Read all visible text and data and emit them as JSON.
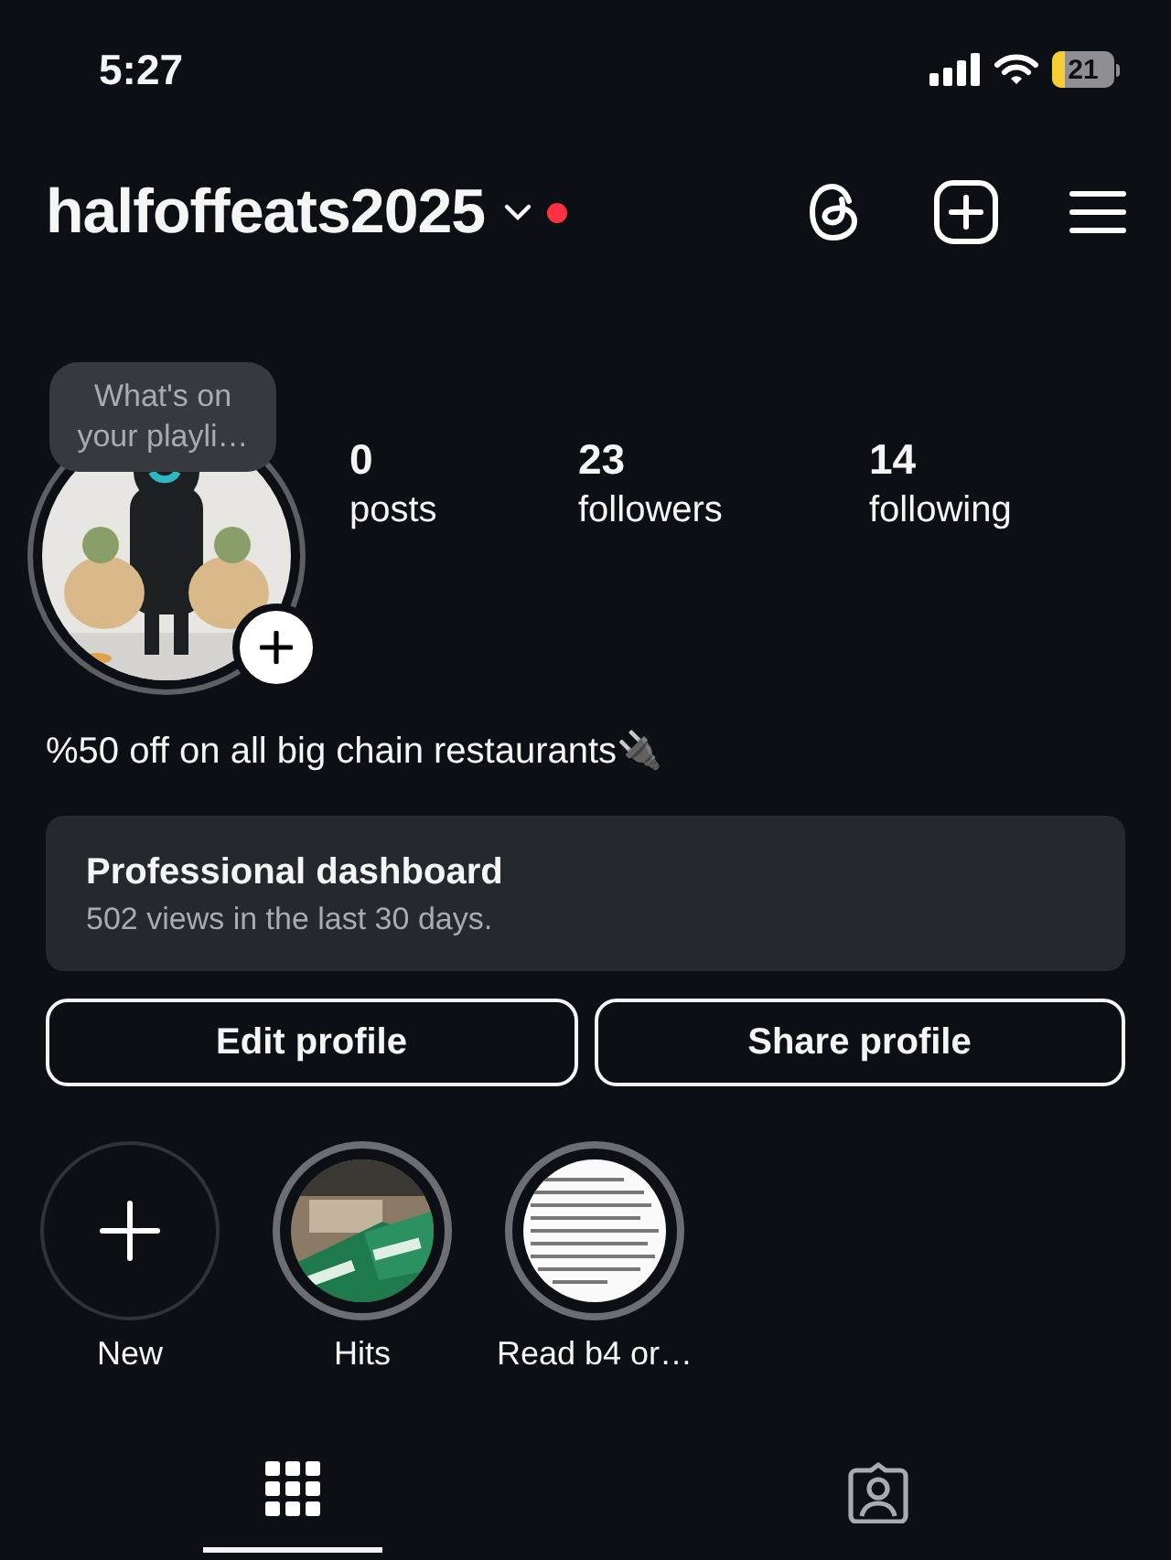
{
  "status_bar": {
    "time": "5:27",
    "battery": "21"
  },
  "header": {
    "username": "halfoffeats2025",
    "notification_dot": true
  },
  "profile": {
    "note": "What's on your playli…",
    "stats": [
      {
        "value": "0",
        "label": "posts"
      },
      {
        "value": "23",
        "label": "followers"
      },
      {
        "value": "14",
        "label": "following"
      }
    ],
    "bio": "%50 off on all big chain restaurants🔌"
  },
  "dashboard": {
    "title": "Professional dashboard",
    "subtitle": "502 views in the last 30 days."
  },
  "buttons": [
    "Edit profile",
    "Share profile"
  ],
  "highlights": [
    {
      "kind": "new",
      "label": "New"
    },
    {
      "kind": "picture",
      "label": "Hits"
    },
    {
      "kind": "document",
      "label": "Read b4 or…"
    }
  ],
  "tabs": [
    {
      "kind": "grid",
      "selected": true
    },
    {
      "kind": "tagged",
      "selected": false
    }
  ]
}
